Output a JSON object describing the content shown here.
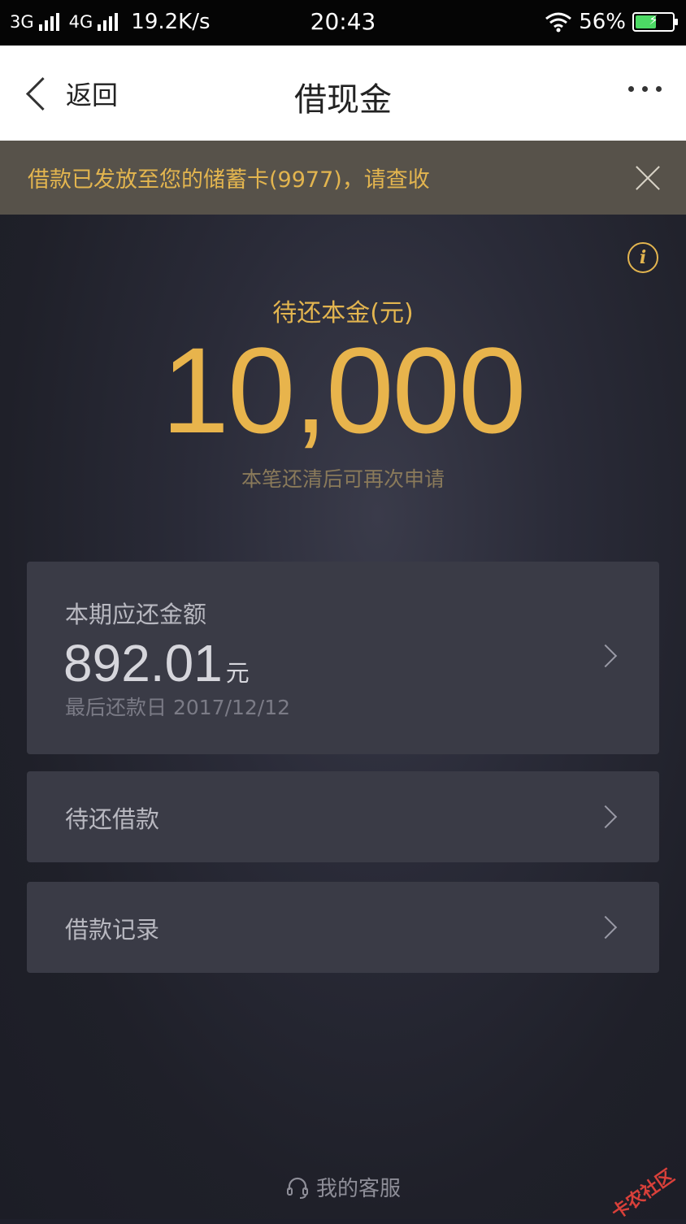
{
  "status_bar": {
    "network1": "3G",
    "network2": "4G",
    "speed": "19.2K/s",
    "time": "20:43",
    "battery_percent": "56%",
    "battery_level": 0.56
  },
  "nav": {
    "back_label": "返回",
    "title": "借现金"
  },
  "notice": {
    "text": "借款已发放至您的储蓄卡(9977)，请查收"
  },
  "principal": {
    "label": "待还本金(元)",
    "amount": "10,000",
    "hint": "本笔还清后可再次申请"
  },
  "current_due": {
    "title": "本期应还金额",
    "amount": "892.01",
    "unit": "元",
    "due_date": "最后还款日 2017/12/12"
  },
  "menu": {
    "pending_loans": "待还借款",
    "loan_records": "借款记录"
  },
  "footer": {
    "service_label": "我的客服"
  },
  "watermark": "卡农社区",
  "colors": {
    "accent": "#e8b44c",
    "notice_bg": "#57524a",
    "card_bg": "#3a3b46"
  }
}
